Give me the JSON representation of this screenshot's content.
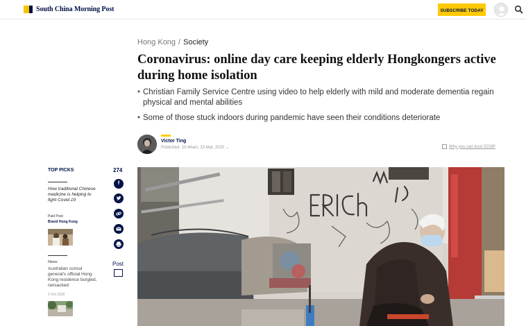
{
  "header": {
    "brand": "South China Morning Post",
    "subscribe_label": "SUBSCRIBE TODAY",
    "icons": [
      "user-avatar-icon",
      "search-icon"
    ]
  },
  "breadcrumb": {
    "section": "Hong Kong",
    "separator": "/",
    "current": "Society"
  },
  "article": {
    "headline": "Coronavirus: online day care keeping elderly Hongkongers active during home isolation",
    "bullets": [
      "Christian Family Service Centre using video to help elderly with mild and moderate dementia regain physical and mental abilities",
      "Some of those stuck indoors during pandemic have seen their conditions deteriorate"
    ],
    "author": "Victor Ting",
    "published": "Published: 10:44am, 23 Mar, 2020",
    "trust_link": "Why you can trust SCMP"
  },
  "sidebar": {
    "top_picks_label": "TOP PICKS",
    "pick_title": "How traditional Chinese medicine is helping to fight Covid-19",
    "paid_post_label": "Paid Post:",
    "paid_post_brand": "Brand Hong Kong",
    "news_label": "News",
    "news_title": "Australian consul general's official Hong Kong residence burgled, ransacked",
    "news_date": "2 Oct 2020"
  },
  "share": {
    "count": "274",
    "icons": [
      "facebook-icon",
      "twitter-icon",
      "link-icon",
      "email-icon",
      "print-icon"
    ],
    "post_label": "Post"
  },
  "colors": {
    "brand_navy": "#001246",
    "brand_yellow": "#ffca05"
  }
}
